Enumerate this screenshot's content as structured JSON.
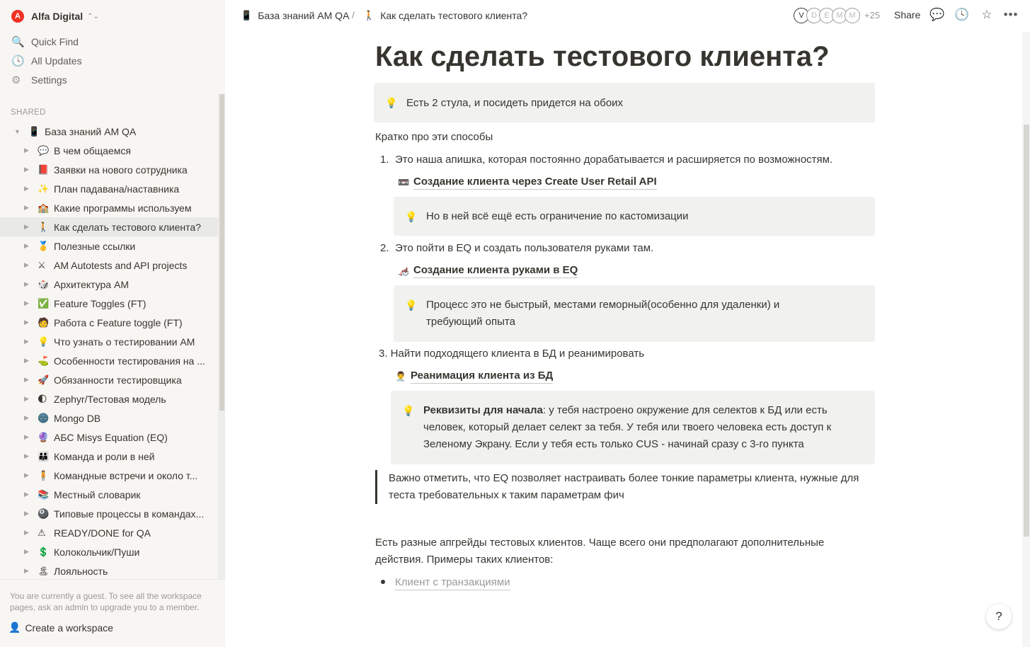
{
  "sidebar": {
    "workspace": "Alfa Digital",
    "workspace_logo": "A",
    "nav": [
      {
        "label": "Quick Find",
        "icon": "🔍"
      },
      {
        "label": "All Updates",
        "icon": "🕓"
      },
      {
        "label": "Settings",
        "icon": "⚙"
      }
    ],
    "shared_label": "SHARED",
    "root": {
      "label": "База знаний AM QA",
      "icon": "📱"
    },
    "items": [
      {
        "label": "В чем общаемся",
        "icon": "💬"
      },
      {
        "label": "Заявки на нового сотрудника",
        "icon": "📕"
      },
      {
        "label": "План падавана/наставника",
        "icon": "✨"
      },
      {
        "label": "Какие программы используем",
        "icon": "🏫"
      },
      {
        "label": "Как сделать тестового клиента?",
        "icon": "🚶"
      },
      {
        "label": "Полезные ссылки",
        "icon": "🥇"
      },
      {
        "label": "AM Autotests and API projects",
        "icon": "⚔"
      },
      {
        "label": "Архитектура AM",
        "icon": "🎲"
      },
      {
        "label": "Feature Toggles (FT)",
        "icon": "✅"
      },
      {
        "label": "Работа с Feature toggle (FT)",
        "icon": "🧑"
      },
      {
        "label": "Что узнать о тестировании AM",
        "icon": "💡"
      },
      {
        "label": "Особенности тестирования на ...",
        "icon": "⛳"
      },
      {
        "label": "Обязанности тестировщика",
        "icon": "🚀"
      },
      {
        "label": "Zephyr/Тестовая модель",
        "icon": "🌓"
      },
      {
        "label": "Mongo DB",
        "icon": "🌚"
      },
      {
        "label": "АБС Misys Equation (EQ)",
        "icon": "🔮"
      },
      {
        "label": "Команда и роли в ней",
        "icon": "👪"
      },
      {
        "label": "Командные встречи и около т...",
        "icon": "🧍"
      },
      {
        "label": "Местный словарик",
        "icon": "📚"
      },
      {
        "label": "Типовые процессы в командах...",
        "icon": "🎱"
      },
      {
        "label": "READY/DONE for QA",
        "icon": "⚠"
      },
      {
        "label": "Колокольчик/Пуши",
        "icon": "💲"
      },
      {
        "label": "Лояльность",
        "icon": "🏝"
      }
    ],
    "guest_note": "You are currently a guest. To see all the workspace pages, ask an admin to upgrade you to a member.",
    "create_workspace": "Create a workspace"
  },
  "topbar": {
    "crumb1": "База знаний AM QA",
    "crumb1_icon": "📱",
    "crumb_sep": "/",
    "crumb2": "Как сделать тестового клиента?",
    "crumb2_icon": "🚶",
    "avatars": [
      "V",
      "D",
      "E",
      "M",
      "M"
    ],
    "avatars_more": "+25",
    "share": "Share"
  },
  "page": {
    "title": "Как сделать тестового клиента?",
    "callout1": "Есть 2 стула, и посидеть придется на обоих",
    "intro": "Кратко про эти способы",
    "item1_num": "1.",
    "item1": "Это наша апишка, которая постоянно дорабатывается и расширяется по возможностям.",
    "link1_icon": "📼",
    "link1": "Создание клиента через Create User Retail API",
    "callout2": "Но в ней всё ещё есть ограничение по кастомизации",
    "item2_num": "2.",
    "item2": "Это пойти в EQ и создать пользователя руками там.",
    "link2_icon": "🦽",
    "link2": "Создание клиента руками в EQ",
    "callout3": "Процесс это не быстрый, местами геморный(особенно для удаленки) и требующий опыта",
    "item3": "3. Найти подходящего клиента в БД и реанимировать",
    "link3_icon": "👨‍⚕️",
    "link3": "Реанимация клиента из БД",
    "callout4_bold": "Реквизиты для начала",
    "callout4_rest": ": у тебя настроено окружение для селектов к БД или есть человек, который делает селект за тебя. У тебя или твоего человека есть доступ к Зеленому Экрану. Если у тебя есть только CUS - начинай сразу с 3-го пункта",
    "quote": "Важно отметить, что EQ позволяет настраивать более тонкие параметры клиента, нужные для теста требовательных к таким параметрам фич",
    "upgrades": "Есть разные апгрейды тестовых клиентов. Чаще всего они предполагают дополнительные действия. Примеры таких клиентов:",
    "bullet_link": "Клиент с транзакциями",
    "bulb": "💡",
    "help": "?"
  },
  "colors": {
    "sidebar_bg": "#f7f6f3",
    "active_bg": "#e9e9e7",
    "callout_bg": "#f1f1ef",
    "text": "#37352f",
    "muted": "#9b9a97",
    "brand": "#ef3124"
  }
}
